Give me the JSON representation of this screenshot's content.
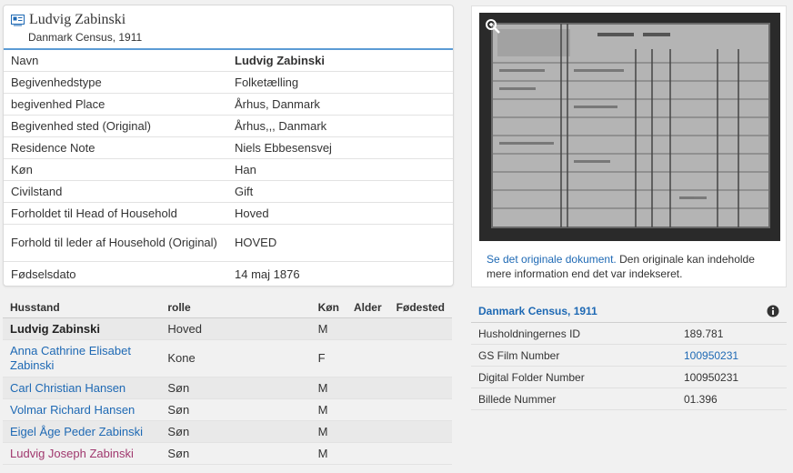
{
  "record": {
    "name": "Ludvig Zabinski",
    "collection": "Danmark Census, 1911"
  },
  "facts": [
    {
      "label": "Navn",
      "value": "Ludvig Zabinski"
    },
    {
      "label": "Begivenhedstype",
      "value": "Folketælling"
    },
    {
      "label": "begivenhed Place",
      "value": "Århus, Danmark"
    },
    {
      "label": "Begivenhed sted (Original)",
      "value": "Århus,,, Danmark"
    },
    {
      "label": "Residence Note",
      "value": "Niels Ebbesensvej"
    },
    {
      "label": "Køn",
      "value": "Han"
    },
    {
      "label": "Civilstand",
      "value": "Gift"
    },
    {
      "label": "Forholdet til Head of Household",
      "value": "Hoved"
    },
    {
      "label": "Forhold til leder af Household (Original)",
      "value": "HOVED"
    },
    {
      "label": "Fødselsdato",
      "value": "14 maj 1876"
    }
  ],
  "household": {
    "headers": [
      "Husstand",
      "rolle",
      "Køn",
      "Alder",
      "Fødested"
    ],
    "rows": [
      {
        "name": "Ludvig Zabinski",
        "role": "Hoved",
        "sex": "M"
      },
      {
        "name": "Anna Cathrine Elisabet Zabinski",
        "role": "Kone",
        "sex": "F"
      },
      {
        "name": "Carl Christian Hansen",
        "role": "Søn",
        "sex": "M"
      },
      {
        "name": "Volmar Richard Hansen",
        "role": "Søn",
        "sex": "M"
      },
      {
        "name": "Eigel Åge Peder Zabinski",
        "role": "Søn",
        "sex": "M"
      },
      {
        "name": "Ludvig Joseph Zabinski",
        "role": "Søn",
        "sex": "M"
      }
    ]
  },
  "image_panel": {
    "link_text": "Se det originale dokument.",
    "note": " Den originale kan indeholde mere information end det var indekseret."
  },
  "census": {
    "title": "Danmark Census, 1911",
    "rows": [
      {
        "label": "Husholdningernes ID",
        "value": "189.781"
      },
      {
        "label": "GS Film Number",
        "value": "100950231"
      },
      {
        "label": "Digital Folder Number",
        "value": "100950231"
      },
      {
        "label": "Billede Nummer",
        "value": "01.396"
      }
    ]
  },
  "colors": {
    "link": "#1e69b4",
    "visited_link": "#a0386e",
    "accent_rule": "#5b9bd5"
  },
  "icons": [
    "record-icon",
    "zoom-icon",
    "info-icon"
  ]
}
